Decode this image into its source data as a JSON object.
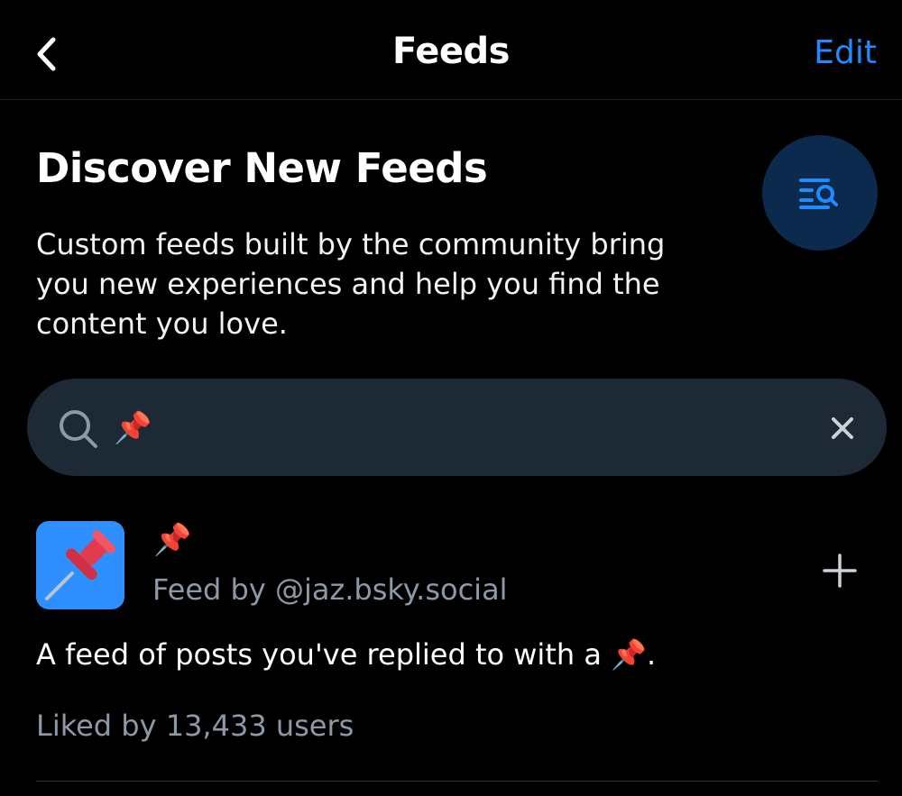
{
  "header": {
    "title": "Feeds",
    "edit_label": "Edit"
  },
  "discover": {
    "title": "Discover New Feeds",
    "description": "Custom feeds built by the community bring you new experiences and help you find the content you love."
  },
  "search": {
    "value": "📌",
    "icon": "search-icon",
    "clear_icon": "close-icon"
  },
  "feed": {
    "name": "📌",
    "creator": "Feed by @jaz.bsky.social",
    "description": "A feed of posts you've replied to with a 📌.",
    "likes": "Liked by 13,433 users",
    "avatar_color": "#2f8fff"
  },
  "colors": {
    "background": "#000000",
    "accent": "#208bfe",
    "search_bg": "#1e2936",
    "discover_icon_bg": "#0c2a4d",
    "muted_text": "#8d99a7"
  }
}
